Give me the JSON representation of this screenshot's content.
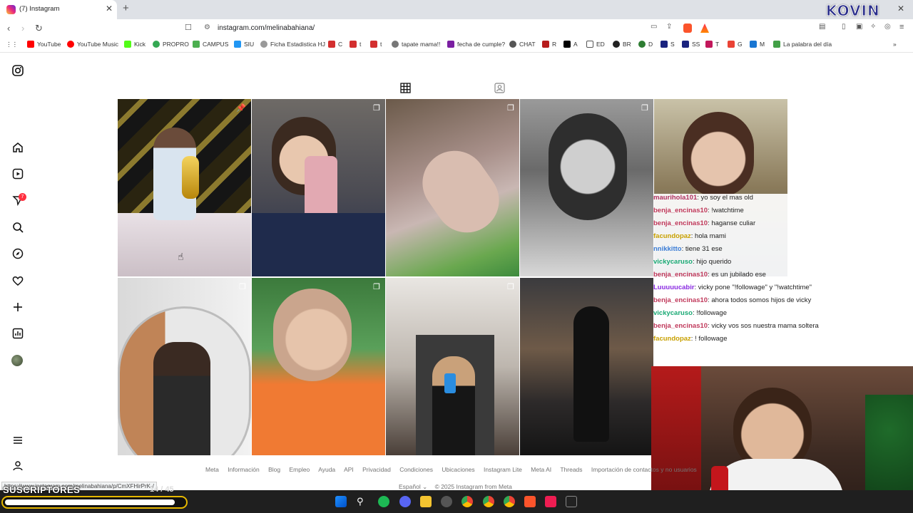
{
  "browser": {
    "tab_title": "(7) Instagram",
    "url": "instagram.com/melinabahiana/",
    "status_url": "https://www.instagram.com/melinabahiana/p/CmXFHirPrK-/",
    "bookmarks": [
      "YouTube",
      "YouTube Music",
      "Kick",
      "PROPRO",
      "CAMPUS",
      "SIU",
      "Ficha Estadistica HJ",
      "C",
      "t",
      "t",
      "tapate mama!!",
      "fecha de cumple?",
      "CHAT",
      "R",
      "A",
      "ED",
      "BR",
      "D",
      "S",
      "SS",
      "T",
      "G",
      "M",
      "La palabra del día"
    ],
    "overlay_logo": "KOVIN"
  },
  "sidebar": {
    "notif_count": "7",
    "icons": [
      "instagram-icon",
      "home-icon",
      "reels-icon",
      "messages-icon",
      "search-icon",
      "explore-icon",
      "heart-icon",
      "create-icon",
      "dashboard-icon",
      "profile-avatar",
      "menu-icon",
      "threads-icon"
    ]
  },
  "grid": {
    "tabs": [
      "posts-grid-icon",
      "tagged-icon"
    ],
    "posts": [
      {
        "label": "post-1",
        "mark": "pin-icon"
      },
      {
        "label": "post-2",
        "mark": "carousel-icon"
      },
      {
        "label": "post-3",
        "mark": "carousel-icon"
      },
      {
        "label": "post-4",
        "mark": "carousel-icon"
      },
      {
        "label": "post-5",
        "mark": ""
      },
      {
        "label": "post-6",
        "mark": "carousel-icon"
      },
      {
        "label": "post-7",
        "mark": "carousel-icon"
      },
      {
        "label": "post-8",
        "mark": "carousel-icon"
      },
      {
        "label": "post-9",
        "mark": ""
      }
    ]
  },
  "chat": [
    {
      "user": "maurihola101",
      "color": "#b03060",
      "text": ": yo soy el mas old"
    },
    {
      "user": "benja_encinas10",
      "color": "#c0395b",
      "text": ": !watchtime"
    },
    {
      "user": "benja_encinas10",
      "color": "#c0395b",
      "text": ": haganse culiar"
    },
    {
      "user": "facundopaz",
      "color": "#c8a000",
      "text": ": hola mami"
    },
    {
      "user": "nnikkitto",
      "color": "#3a7bd5",
      "text": ": tiene 31 ese"
    },
    {
      "user": "vickycaruso",
      "color": "#19a974",
      "text": ": hijo querido"
    },
    {
      "user": "benja_encinas10",
      "color": "#c0395b",
      "text": ": es un jubilado ese"
    },
    {
      "user": "Luuuuucabir",
      "color": "#8a2be2",
      "text": ": vicky pone \"!followage\" y \"!watchtime\""
    },
    {
      "user": "benja_encinas10",
      "color": "#c0395b",
      "text": ": ahora todos somos hijos de vicky"
    },
    {
      "user": "vickycaruso",
      "color": "#19a974",
      "text": ": !followage"
    },
    {
      "user": "benja_encinas10",
      "color": "#c0395b",
      "text": ": vicky vos sos nuestra mama soltera"
    },
    {
      "user": "facundopaz",
      "color": "#c8a000",
      "text": ": ! followage"
    }
  ],
  "footer": {
    "links": [
      "Meta",
      "Información",
      "Blog",
      "Empleo",
      "Ayuda",
      "API",
      "Privacidad",
      "Condiciones",
      "Ubicaciones",
      "Instagram Lite",
      "Meta AI",
      "Threads",
      "Importación de contactos y no usuarios"
    ],
    "language": "Español",
    "copyright": "© 2025 Instagram from Meta"
  },
  "stream": {
    "subs_label": "SUSCRIPTORES",
    "subs_count": "14 / 45",
    "subs_progress": 0.95
  }
}
